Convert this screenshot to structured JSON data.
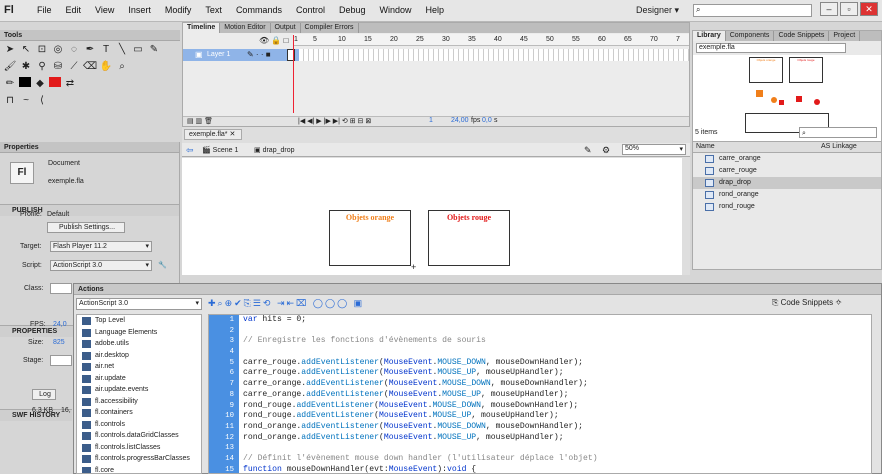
{
  "app": {
    "logo": "Fl",
    "menus": [
      "File",
      "Edit",
      "View",
      "Insert",
      "Modify",
      "Text",
      "Commands",
      "Control",
      "Debug",
      "Window",
      "Help"
    ],
    "workspace": "Designer"
  },
  "tools": {
    "title": "Tools"
  },
  "timeline": {
    "tabs": [
      "Timeline",
      "Motion Editor",
      "Output",
      "Compiler Errors"
    ],
    "ruler": [
      "1",
      "5",
      "10",
      "15",
      "20",
      "25",
      "30",
      "35",
      "40",
      "45",
      "50",
      "55",
      "60",
      "65",
      "70",
      "7"
    ],
    "layer": "Layer 1",
    "fps": "24,00",
    "fps_unit": "fps",
    "time": "0,0",
    "time_unit": "s",
    "frame": "1"
  },
  "library": {
    "tabs": [
      "Library",
      "Components",
      "Code Snippets",
      "Project"
    ],
    "file": "exemple.fla",
    "count": "5 items",
    "col_name": "Name",
    "col_link": "AS Linkage",
    "items": [
      "carre_orange",
      "carre_rouge",
      "drap_drop",
      "rond_orange",
      "rond_rouge"
    ],
    "selected_index": 2,
    "preview_labels": [
      "Objets orange",
      "Objets rouge"
    ]
  },
  "properties": {
    "title": "Properties",
    "doc_type": "Document",
    "doc_name": "exemple.fla",
    "publish": "PUBLISH",
    "profile_label": "Profile:",
    "profile": "Default",
    "publish_btn": "Publish Settings...",
    "target_label": "Target:",
    "target": "Flash Player 11.2",
    "script_label": "Script:",
    "script": "ActionScript 3.0",
    "class_label": "Class:",
    "props": "PROPERTIES",
    "fps_label": "FPS:",
    "fps": "24,0",
    "size_label": "Size:",
    "size": "825",
    "stage_label": "Stage:",
    "swf": "SWF HISTORY",
    "log_btn": "Log",
    "kb": "6.3 KB",
    "kb2": "16,"
  },
  "doc": {
    "tab": "exemple.fla*",
    "scene": "Scene 1",
    "symbol": "drap_drop",
    "zoom": "50%",
    "box1": "Objets orange",
    "box2": "Objets rouge"
  },
  "actions": {
    "title": "Actions",
    "script": "ActionScript 3.0",
    "snippets": "Code Snippets",
    "tree": [
      "Top Level",
      "Language Elements",
      "adobe.utils",
      "air.desktop",
      "air.net",
      "air.update",
      "air.update.events",
      "fl.accessibility",
      "fl.containers",
      "fl.controls",
      "fl.controls.dataGridClasses",
      "fl.controls.listClasses",
      "fl.controls.progressBarClasses",
      "fl.core"
    ],
    "code": [
      "var hits = 0;",
      "",
      "// Enregistre les fonctions d'évènements de souris",
      "",
      "carre_rouge.addEventListener(MouseEvent.MOUSE_DOWN, mouseDownHandler);",
      "carre_rouge.addEventListener(MouseEvent.MOUSE_UP, mouseUpHandler);",
      "carre_orange.addEventListener(MouseEvent.MOUSE_DOWN, mouseDownHandler);",
      "carre_orange.addEventListener(MouseEvent.MOUSE_UP, mouseUpHandler);",
      "rond_rouge.addEventListener(MouseEvent.MOUSE_DOWN, mouseDownHandler);",
      "rond_rouge.addEventListener(MouseEvent.MOUSE_UP, mouseUpHandler);",
      "rond_orange.addEventListener(MouseEvent.MOUSE_DOWN, mouseDownHandler);",
      "rond_orange.addEventListener(MouseEvent.MOUSE_UP, mouseUpHandler);",
      "",
      "// Définit l'évènement mouse down handler (l'utilisateur déplace l'objet)",
      "function mouseDownHandler(evt:MouseEvent):void {"
    ]
  },
  "colors": {
    "accent": "#4a90e2",
    "orange": "#f07f1a",
    "red": "#e21a1a"
  }
}
